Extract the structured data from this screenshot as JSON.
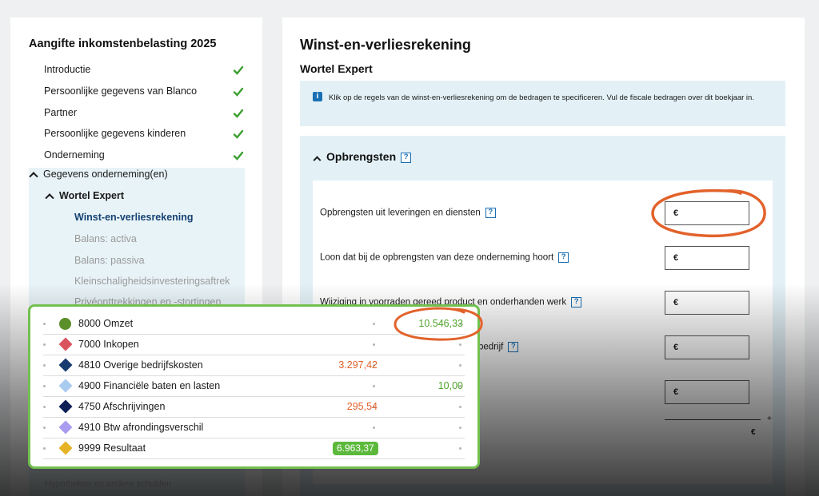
{
  "sidebar": {
    "title": "Aangifte inkomstenbelasting 2025",
    "steps": [
      {
        "label": "Introductie",
        "done": true
      },
      {
        "label": "Persoonlijke gegevens van Blanco",
        "done": true
      },
      {
        "label": "Partner",
        "done": true
      },
      {
        "label": "Persoonlijke gegevens kinderen",
        "done": true
      },
      {
        "label": "Onderneming",
        "done": true
      }
    ],
    "group_label": "Gegevens onderneming(en)",
    "company_label": "Wortel Expert",
    "subitems": [
      {
        "label": "Winst-en-verliesrekening",
        "active": true
      },
      {
        "label": "Balans: activa",
        "active": false
      },
      {
        "label": "Balans: passiva",
        "active": false
      },
      {
        "label": "Kleinschaligheidsinvesteringsaftrek",
        "active": false
      },
      {
        "label": "Privéonttrekkingen en -stortingen",
        "active": false
      }
    ],
    "check_color": "#3aa02f"
  },
  "main": {
    "title": "Winst-en-verliesrekening",
    "subtitle": "Wortel Expert",
    "info": "Klik op de regels van de winst-en-verliesrekening om de bedragen te specificeren. Vul de fiscale bedragen over dit boekjaar in.",
    "info_icon": "i",
    "section_title": "Opbrengsten",
    "help_symbol": "?",
    "fields": [
      {
        "label": "Opbrengsten uit leveringen en diensten",
        "value": "€",
        "help": true
      },
      {
        "label": "Loon dat bij de opbrengsten van deze onderneming hoort",
        "value": "€",
        "help": true
      },
      {
        "label": "Wijziging in voorraden gereed product en onderhanden werk",
        "value": "€",
        "help": true
      },
      {
        "label": "bedrijf",
        "value": "€",
        "help": true
      },
      {
        "label": "",
        "value": "€",
        "help": false
      }
    ],
    "plus_sign": "+",
    "total_value": "€"
  },
  "ledger": {
    "rows": [
      {
        "code_name": "8000 Omzet",
        "shape": "circle",
        "color": "#5a8f2a",
        "debit": "",
        "credit": "10.546,33",
        "result": false
      },
      {
        "code_name": "7000 Inkopen",
        "shape": "diamond",
        "color": "#d9545e",
        "debit": "",
        "credit": "",
        "result": false
      },
      {
        "code_name": "4810 Overige bedrijfskosten",
        "shape": "diamond",
        "color": "#163b6e",
        "debit": "3.297,42",
        "credit": "",
        "result": false
      },
      {
        "code_name": "4900 Financiële baten en lasten",
        "shape": "diamond",
        "color": "#a9cbf0",
        "debit": "",
        "credit": "10,00",
        "result": false
      },
      {
        "code_name": "4750 Afschrijvingen",
        "shape": "diamond",
        "color": "#0f1f55",
        "debit": "295,54",
        "credit": "",
        "result": false
      },
      {
        "code_name": "4910 Btw afrondingsverschil",
        "shape": "diamond",
        "color": "#a99cf0",
        "debit": "",
        "credit": "",
        "result": false
      },
      {
        "code_name": "9999 Resultaat",
        "shape": "diamond",
        "color": "#e6b325",
        "debit": "6.963,37",
        "credit": "",
        "result": true
      }
    ]
  },
  "footer_text": "Hypotheken en andere schulden",
  "colors": {
    "accent_orange": "#e2622b",
    "ledger_border": "#72c04f",
    "link_blue": "#154273"
  }
}
